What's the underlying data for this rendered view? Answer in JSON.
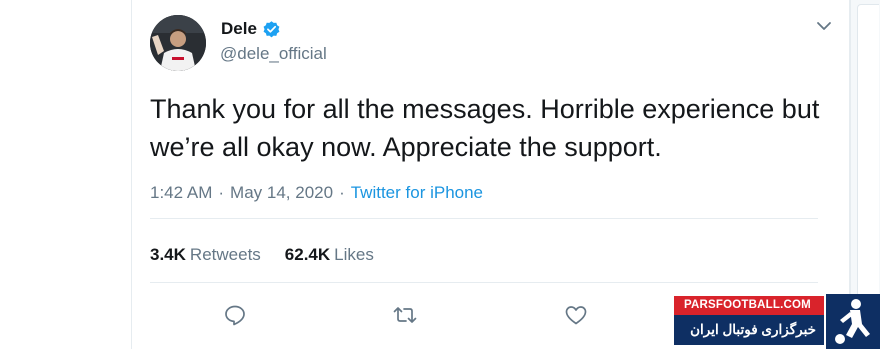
{
  "tweet": {
    "display_name": "Dele",
    "handle": "@dele_official",
    "text": "Thank you for all the messages. Horrible experience but we’re all okay now. Appreciate the support.",
    "time": "1:42 AM",
    "separator": "·",
    "date": "May 14, 2020",
    "source": "Twitter for iPhone"
  },
  "stats": {
    "retweets_count": "3.4K",
    "retweets_label": "Retweets",
    "likes_count": "62.4K",
    "likes_label": "Likes"
  },
  "icons": {
    "verified": "verified-badge-icon",
    "caret": "chevron-down-icon",
    "reply": "reply-icon",
    "retweet": "retweet-icon",
    "like": "heart-icon"
  },
  "colors": {
    "link": "#1b95e0",
    "verified": "#1da1f2",
    "muted": "#657786",
    "text": "#14171a"
  },
  "watermark": {
    "top_text": "PARSFOOTBALL.COM",
    "bottom_text": "خبرگزاری فوتبال ایران"
  }
}
